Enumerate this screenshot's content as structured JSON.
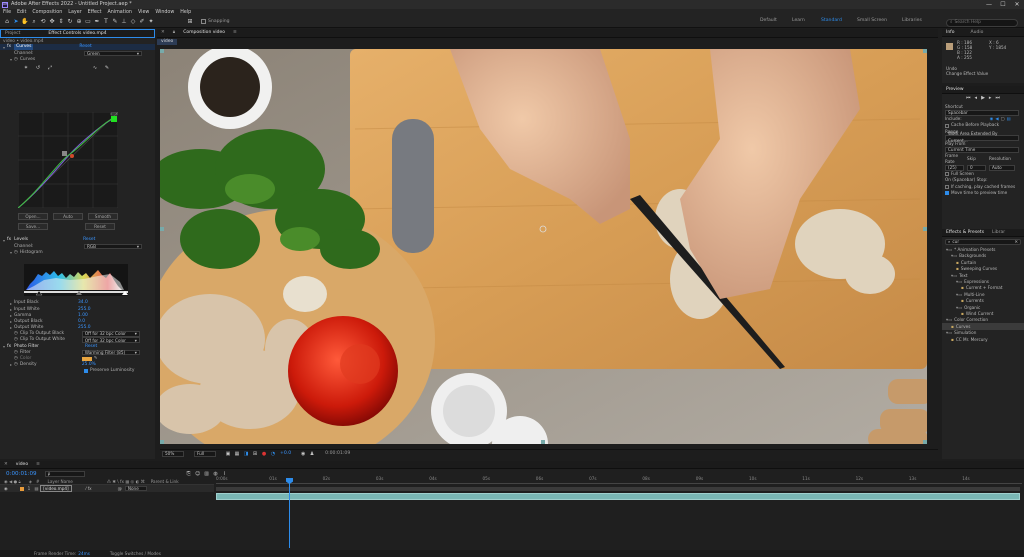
{
  "app": {
    "title": "Adobe After Effects 2022 - Untitled Project.aep *",
    "window_controls": [
      "—",
      "☐",
      "✕"
    ]
  },
  "menu": [
    "File",
    "Edit",
    "Composition",
    "Layer",
    "Effect",
    "Animation",
    "View",
    "Window",
    "Help"
  ],
  "toolbar": {
    "snapping_label": "Snapping",
    "workspaces": [
      "Default",
      "Learn",
      "Standard",
      "Small Screen",
      "Libraries"
    ],
    "active_workspace": "Standard",
    "search_placeholder": "Search Help"
  },
  "project_panel": {
    "tabs": [
      "Project",
      "Effect Controls video.mp4"
    ],
    "breadcrumb": "video • video.mp4"
  },
  "effect_controls": {
    "curves": {
      "name": "Curves",
      "reset": "Reset",
      "channel_label": "Channel:",
      "channel_value": "Green",
      "curves_label": "Curves",
      "buttons": [
        "Open...",
        "Auto",
        "Smooth",
        "Save...",
        "Reset"
      ]
    },
    "levels": {
      "name": "Levels",
      "reset": "Reset",
      "channel_label": "Channel:",
      "channel_value": "RGB",
      "histogram_label": "Histogram",
      "params": [
        {
          "label": "Input Black",
          "value": "34.0"
        },
        {
          "label": "Input White",
          "value": "255.0"
        },
        {
          "label": "Gamma",
          "value": "1.00"
        },
        {
          "label": "Output Black",
          "value": "0.0"
        },
        {
          "label": "Output White",
          "value": "255.0"
        }
      ],
      "clip_black_label": "Clip To Output Black",
      "clip_black_value": "Off for 32 bpc Color",
      "clip_white_label": "Clip To Output White",
      "clip_white_value": "Off for 32 bpc Color"
    },
    "photo_filter": {
      "name": "Photo Filter",
      "reset": "Reset",
      "filter_label": "Filter",
      "filter_value": "Warming Filter (85)",
      "color_label": "Color",
      "density_label": "Density",
      "density_value": "25.0%",
      "preserve_label": "Preserve Luminosity"
    }
  },
  "composition": {
    "tab": "Composition video",
    "subtab": "video",
    "footer": {
      "zoom": "50%",
      "resolution": "Full",
      "exposure": "+0.0",
      "timecode": "0:00:01:09"
    }
  },
  "info_panel": {
    "tabs": [
      "Info",
      "Audio"
    ],
    "r_label": "R :",
    "r_value": "186",
    "g_label": "G :",
    "g_value": "158",
    "b_label": "B :",
    "b_value": "122",
    "a_label": "A :",
    "a_value": "255",
    "x_label": "X :",
    "x_value": "6",
    "y_label": "Y :",
    "y_value": "1854",
    "undo_label": "Undo",
    "undo_text": "Change Effect Value"
  },
  "preview_panel": {
    "title": "Preview",
    "shortcut_label": "Shortcut",
    "shortcut_value": "Spacebar",
    "include_label": "Include:",
    "cache_label": "Cache Before Playback",
    "range_label": "Range",
    "range_value": "Work Area Extended By Current...",
    "play_from_label": "Play From",
    "play_from_value": "Current Time",
    "frame_rate_label": "Frame Rate",
    "frame_rate_value": "(25)",
    "skip_label": "Skip",
    "skip_value": "0",
    "resolution_label": "Resolution",
    "resolution_value": "Auto",
    "full_screen_label": "Full Screen",
    "on_stop_label": "On (Spacebar) Stop:",
    "if_caching_label": "If caching, play cached frames",
    "move_time_label": "Move time to preview time"
  },
  "effects_presets": {
    "tabs": [
      "Effects & Presets",
      "Librar"
    ],
    "search_value": "cur",
    "tree": [
      {
        "label": "* Animation Presets",
        "level": 0,
        "folder": true
      },
      {
        "label": "Backgrounds",
        "level": 1,
        "folder": true
      },
      {
        "label": "Curtain",
        "level": 2,
        "folder": false
      },
      {
        "label": "Sweeping Curves",
        "level": 2,
        "folder": false
      },
      {
        "label": "Text",
        "level": 1,
        "folder": true
      },
      {
        "label": "Expressions",
        "level": 2,
        "folder": true
      },
      {
        "label": "Current + Format",
        "level": 3,
        "folder": false
      },
      {
        "label": "Multi-Line",
        "level": 2,
        "folder": true
      },
      {
        "label": "Currents",
        "level": 3,
        "folder": false
      },
      {
        "label": "Organic",
        "level": 2,
        "folder": true
      },
      {
        "label": "Wind Current",
        "level": 3,
        "folder": false
      },
      {
        "label": "Color Correction",
        "level": 0,
        "folder": true
      },
      {
        "label": "Curves",
        "level": 1,
        "folder": false,
        "selected": true
      },
      {
        "label": "Simulation",
        "level": 0,
        "folder": true
      },
      {
        "label": "CC Mr. Mercury",
        "level": 1,
        "folder": false
      }
    ]
  },
  "timeline": {
    "tab": "video",
    "timecode": "0:00:01:09",
    "search_placeholder": "ρ",
    "columns": [
      "Layer Name",
      "Parent & Link"
    ],
    "layer_number": "1",
    "layer_name": "[video.mp4]",
    "parent_value": "None",
    "ruler_ticks": [
      "0:00s",
      "01s",
      "02s",
      "03s",
      "04s",
      "05s",
      "06s",
      "07s",
      "08s",
      "09s",
      "10s",
      "11s",
      "12s",
      "13s",
      "14s"
    ],
    "footer_render_label": "Frame Render Time:",
    "footer_render_value": "24ms",
    "footer_toggle": "Toggle Switches / Modes"
  },
  "colors": {
    "accent": "#2d8ceb",
    "panel_bg": "#232323",
    "app_bg": "#1d1d1d",
    "track_bar": "#7ab7b5",
    "label_orange": "#e89b3a"
  }
}
